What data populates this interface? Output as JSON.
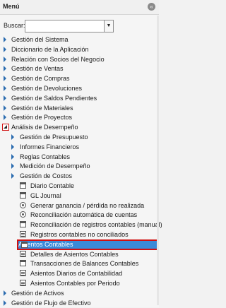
{
  "header": {
    "title": "Menú",
    "collapse_glyph": "«"
  },
  "search": {
    "label": "Buscar:",
    "value": "",
    "dropdown_glyph": "▼"
  },
  "tree": [
    {
      "label": "Gestión del Sistema",
      "level": 0,
      "kind": "folder"
    },
    {
      "label": "Diccionario de la Aplicación",
      "level": 0,
      "kind": "folder"
    },
    {
      "label": "Relación con Socios del Negocio",
      "level": 0,
      "kind": "folder"
    },
    {
      "label": "Gestión de Ventas",
      "level": 0,
      "kind": "folder"
    },
    {
      "label": "Gestión de Compras",
      "level": 0,
      "kind": "folder"
    },
    {
      "label": "Gestión de Devoluciones",
      "level": 0,
      "kind": "folder"
    },
    {
      "label": "Gestión de Saldos Pendientes",
      "level": 0,
      "kind": "folder"
    },
    {
      "label": "Gestión de Materiales",
      "level": 0,
      "kind": "folder"
    },
    {
      "label": "Gestión de Proyectos",
      "level": 0,
      "kind": "folder"
    },
    {
      "label": "Análisis de Desempeño",
      "level": 0,
      "kind": "open"
    },
    {
      "label": "Gestión de Presupuesto",
      "level": 1,
      "kind": "folder"
    },
    {
      "label": "Informes Financieros",
      "level": 1,
      "kind": "folder"
    },
    {
      "label": "Reglas Contables",
      "level": 1,
      "kind": "folder"
    },
    {
      "label": "Medición de Desempeño",
      "level": 1,
      "kind": "folder"
    },
    {
      "label": "Gestión de Costos",
      "level": 1,
      "kind": "folder"
    },
    {
      "label": "Diario Contable",
      "level": 2,
      "kind": "window"
    },
    {
      "label": "GL Journal",
      "level": 2,
      "kind": "window"
    },
    {
      "label": "Generar ganancia / pérdida no realizada",
      "level": 2,
      "kind": "process"
    },
    {
      "label": "Reconciliación automática de cuentas",
      "level": 2,
      "kind": "process"
    },
    {
      "label": "Reconciliación de registros contables (manual)",
      "level": 2,
      "kind": "window"
    },
    {
      "label": "Registros contables no conciliados",
      "level": 2,
      "kind": "report"
    },
    {
      "label": "Asientos Contables",
      "level": 2,
      "kind": "window",
      "selected": true
    },
    {
      "label": "Detalles de Asientos Contables",
      "level": 2,
      "kind": "report"
    },
    {
      "label": "Transacciones de Balances Contables",
      "level": 2,
      "kind": "window"
    },
    {
      "label": "Asientos Diarios de Contabilidad",
      "level": 2,
      "kind": "report"
    },
    {
      "label": "Asientos Contables por Periodo",
      "level": 2,
      "kind": "report"
    },
    {
      "label": "Gestión de Activos",
      "level": 0,
      "kind": "folder"
    },
    {
      "label": "Gestión de Flujo de Efectivo",
      "level": 0,
      "kind": "folder"
    }
  ],
  "colors": {
    "accent": "#3a8ad8",
    "highlight_border": "#d01010",
    "tree_arrow": "#2b6cb0"
  }
}
